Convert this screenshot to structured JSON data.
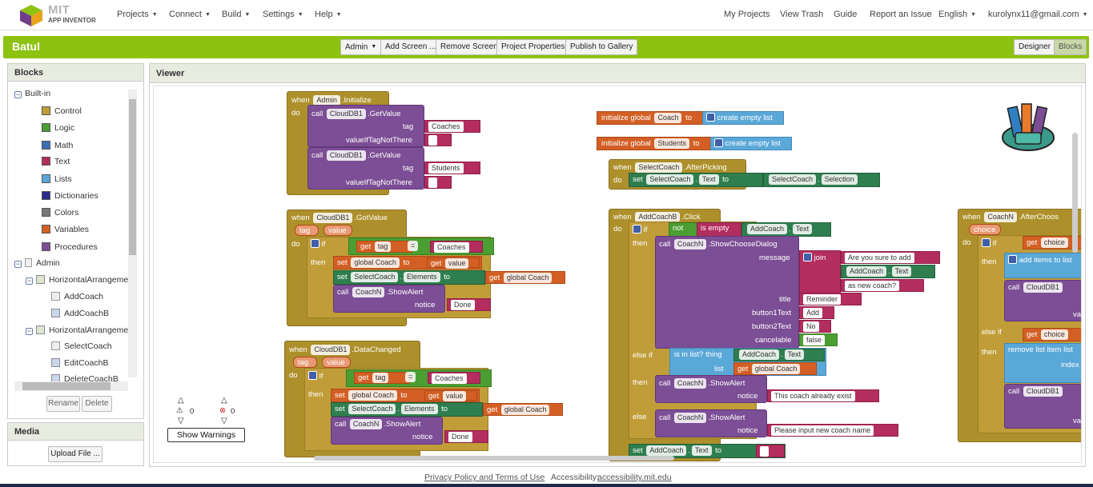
{
  "top_menu": {
    "logo_title": "MIT",
    "logo_subtitle": "APP INVENTOR",
    "items": [
      "Projects",
      "Connect",
      "Build",
      "Settings",
      "Help"
    ],
    "right": [
      "My Projects",
      "View Trash",
      "Guide",
      "Report an Issue"
    ],
    "language": "English",
    "account": "kurolynx11@gmail.com"
  },
  "titlebar": {
    "project": "Batul",
    "screen": "Admin",
    "buttons": [
      "Add Screen ...",
      "Remove Screen",
      "Project Properties",
      "Publish to Gallery"
    ],
    "designer": "Designer",
    "blocks": "Blocks"
  },
  "blocks_panel": {
    "title": "Blocks",
    "builtin": "Built-in",
    "categories": [
      {
        "label": "Control",
        "color": "#c09d38"
      },
      {
        "label": "Logic",
        "color": "#4b9e32"
      },
      {
        "label": "Math",
        "color": "#3f6fb5"
      },
      {
        "label": "Text",
        "color": "#b32d5e"
      },
      {
        "label": "Lists",
        "color": "#5aa8d8"
      },
      {
        "label": "Dictionaries",
        "color": "#2a2a8c"
      },
      {
        "label": "Colors",
        "color": "#777777"
      },
      {
        "label": "Variables",
        "color": "#d35f24"
      },
      {
        "label": "Procedures",
        "color": "#7c4e95"
      }
    ],
    "components": {
      "screen": "Admin",
      "arr1": "HorizontalArrangemen",
      "arr1_children": [
        "AddCoach",
        "AddCoachB"
      ],
      "arr2": "HorizontalArrangemen",
      "arr2_children": [
        "SelectCoach",
        "EditCoachB",
        "DeleteCoachB"
      ]
    },
    "rename": "Rename",
    "delete": "Delete"
  },
  "media_panel": {
    "title": "Media",
    "upload": "Upload File ..."
  },
  "viewer": {
    "title": "Viewer",
    "warnings_count": "0",
    "errors_count": "0",
    "show_warnings": "Show Warnings"
  },
  "blocks": {
    "when": "when",
    "do": "do",
    "call": "call",
    "set": "set",
    "to": "to",
    "tag": "tag",
    "value": "value",
    "then": "then",
    "else": "else",
    "else_if": "else if",
    "if": "if",
    "get": "get",
    "init_global": "initialize global",
    "create_empty_list": "create empty list",
    "admin": "Admin",
    "initialize": ".Initialize",
    "clouddb1": "CloudDB1",
    "getvalue": ".GetValue",
    "got_value": ".GotValue",
    "data_changed": ".DataChanged",
    "value_if_not": "valueIfTagNotThere",
    "coaches": "Coaches",
    "students": "Students",
    "coach_var": "Coach",
    "students_var": "Students",
    "selectcoach": "SelectCoach",
    "afterpicking": ".AfterPicking",
    "text_prop": "Text",
    "selection": "Selection",
    "elements": "Elements",
    "global_coach": "global Coach",
    "coachn": "CoachN",
    "showalert": ".ShowAlert",
    "notice": "notice",
    "done": "Done",
    "eq": "=",
    "addcoachb": "AddCoachB",
    "click": ".Click",
    "not": "not",
    "is_empty": "is empty",
    "addcoach": "AddCoach",
    "showchoose": ".ShowChooseDialog",
    "message": "message",
    "join": "join",
    "are_you_sure": "Are you sure to add",
    "as_new_coach": "as new coach?",
    "title": "title",
    "reminder": "Reminder",
    "button1": "button1Text",
    "add": "Add",
    "button2": "button2Text",
    "no": "No",
    "cancelable": "cancelable",
    "false": "false",
    "is_in_list": "is in list? thing",
    "list": "list",
    "already_exist": "This coach already exist",
    "please_input": "Please input new coach name",
    "afterchoos": ".AfterChoos",
    "choice": "choice",
    "add_items": "add items to list",
    "remove_item": "remove list item  list",
    "index": "index",
    "val": "val"
  },
  "footer": {
    "privacy": "Privacy Policy and Terms of Use",
    "accessibility_label": "Accessibility:",
    "accessibility_link": "accessibility.mit.edu"
  }
}
